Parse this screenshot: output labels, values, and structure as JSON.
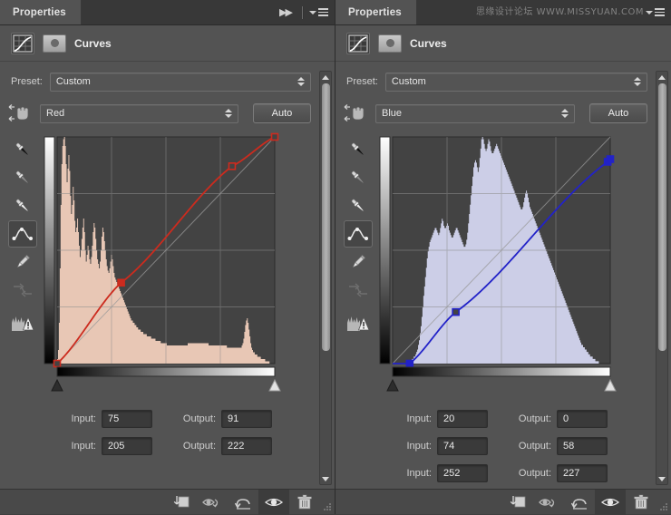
{
  "watermark": "思缘设计论坛  WWW.MISSYUAN.COM",
  "panels": [
    {
      "tab_label": "Properties",
      "title": "Curves",
      "preset_label": "Preset:",
      "preset_value": "Custom",
      "channel_value": "Red",
      "auto_label": "Auto",
      "curve_color": "#cc2b1e",
      "histogram_fill": "#f6d2bf",
      "input_label": "Input:",
      "output_label": "Output:",
      "points": [
        {
          "input": "75",
          "output": "91"
        },
        {
          "input": "205",
          "output": "222"
        }
      ],
      "icons": {
        "adjustment": "curves-adjustment-icon",
        "mask": "layer-mask-icon",
        "collapse": "collapse-panel-icon",
        "menu": "panel-menu-icon",
        "targeted_adjust": "targeted-adjustment-icon"
      },
      "tools": [
        "black-point-eyedropper-icon",
        "gray-point-eyedropper-icon",
        "white-point-eyedropper-icon",
        "curve-point-tool-icon",
        "pencil-tool-icon",
        "smooth-curve-icon",
        "clipping-warning-icon"
      ],
      "active_tool_index": 3,
      "bottom_buttons": [
        "clip-to-layer-icon",
        "view-previous-state-icon",
        "reset-adjustment-icon",
        "toggle-layer-visibility-icon",
        "delete-adjustment-layer-icon"
      ],
      "active_bottom_index": 3
    },
    {
      "tab_label": "Properties",
      "title": "Curves",
      "preset_label": "Preset:",
      "preset_value": "Custom",
      "channel_value": "Blue",
      "auto_label": "Auto",
      "curve_color": "#2222c8",
      "histogram_fill": "#d8daf5",
      "input_label": "Input:",
      "output_label": "Output:",
      "points": [
        {
          "input": "20",
          "output": "0"
        },
        {
          "input": "74",
          "output": "58"
        },
        {
          "input": "252",
          "output": "227"
        }
      ],
      "icons": {
        "adjustment": "curves-adjustment-icon",
        "mask": "layer-mask-icon",
        "collapse": "collapse-panel-icon",
        "menu": "panel-menu-icon",
        "targeted_adjust": "targeted-adjustment-icon"
      },
      "tools": [
        "black-point-eyedropper-icon",
        "gray-point-eyedropper-icon",
        "white-point-eyedropper-icon",
        "curve-point-tool-icon",
        "pencil-tool-icon",
        "smooth-curve-icon",
        "clipping-warning-icon"
      ],
      "active_tool_index": 3,
      "bottom_buttons": [
        "clip-to-layer-icon",
        "view-previous-state-icon",
        "reset-adjustment-icon",
        "toggle-layer-visibility-icon",
        "delete-adjustment-layer-icon"
      ],
      "active_bottom_index": 3
    }
  ],
  "chart_data": [
    {
      "type": "line",
      "title": "Red channel curve",
      "xlabel": "Input",
      "ylabel": "Output",
      "xlim": [
        0,
        255
      ],
      "ylim": [
        0,
        255
      ],
      "grid": true,
      "curve_points": [
        [
          0,
          0
        ],
        [
          75,
          91
        ],
        [
          205,
          222
        ],
        [
          255,
          255
        ]
      ],
      "baseline": [
        [
          0,
          0
        ],
        [
          255,
          255
        ]
      ],
      "histogram": [
        2,
        6,
        18,
        42,
        70,
        88,
        96,
        99,
        100,
        96,
        88,
        80,
        86,
        92,
        85,
        74,
        66,
        70,
        78,
        72,
        63,
        58,
        60,
        64,
        58,
        52,
        47,
        50,
        55,
        60,
        64,
        58,
        50,
        45,
        48,
        52,
        50,
        46,
        44,
        47,
        52,
        58,
        62,
        60,
        55,
        50,
        46,
        44,
        42,
        45,
        50,
        56,
        60,
        58,
        54,
        50,
        46,
        43,
        41,
        40,
        42,
        45,
        48,
        46,
        43,
        40,
        38,
        37,
        36,
        35,
        34,
        33,
        32,
        31,
        30,
        29,
        28,
        27,
        26,
        25,
        24,
        23,
        22,
        21,
        20,
        19,
        19,
        18,
        18,
        17,
        17,
        16,
        16,
        15,
        15,
        15,
        14,
        14,
        14,
        13,
        13,
        13,
        13,
        12,
        12,
        12,
        12,
        12,
        11,
        11,
        11,
        11,
        11,
        10,
        10,
        10,
        10,
        10,
        10,
        9,
        9,
        9,
        9,
        9,
        9,
        9,
        8,
        8,
        8,
        8,
        8,
        8,
        8,
        8,
        8,
        8,
        8,
        8,
        8,
        8,
        8,
        8,
        8,
        8,
        8,
        8,
        8,
        8,
        8,
        8,
        9,
        9,
        9,
        9,
        9,
        9,
        9,
        9,
        9,
        9,
        9,
        9,
        9,
        9,
        9,
        9,
        9,
        9,
        9,
        9,
        9,
        9,
        9,
        9,
        8,
        8,
        8,
        8,
        8,
        8,
        8,
        8,
        8,
        8,
        8,
        8,
        8,
        8,
        8,
        8,
        8,
        8,
        8,
        8,
        8,
        7,
        7,
        7,
        7,
        7,
        7,
        7,
        7,
        7,
        7,
        7,
        7,
        7,
        7,
        7,
        7,
        7,
        8,
        9,
        11,
        14,
        17,
        19,
        20,
        18,
        15,
        12,
        9,
        7,
        6,
        5,
        5,
        4,
        4,
        4,
        3,
        3,
        3,
        3,
        2,
        2,
        2,
        2,
        2,
        1,
        1,
        1,
        1,
        1,
        0,
        0,
        0,
        0,
        0,
        0
      ]
    },
    {
      "type": "line",
      "title": "Blue channel curve",
      "xlabel": "Input",
      "ylabel": "Output",
      "xlim": [
        0,
        255
      ],
      "ylim": [
        0,
        255
      ],
      "grid": true,
      "curve_points": [
        [
          20,
          0
        ],
        [
          74,
          58
        ],
        [
          252,
          227
        ],
        [
          255,
          230
        ]
      ],
      "baseline": [
        [
          0,
          0
        ],
        [
          255,
          255
        ]
      ],
      "histogram": [
        0,
        0,
        0,
        0,
        0,
        0,
        0,
        0,
        0,
        0,
        0,
        0,
        0,
        0,
        0,
        0,
        0,
        0,
        0,
        0,
        1,
        1,
        2,
        2,
        3,
        3,
        4,
        5,
        6,
        8,
        10,
        13,
        16,
        20,
        24,
        29,
        33,
        37,
        41,
        45,
        48,
        50,
        52,
        53,
        54,
        55,
        56,
        57,
        58,
        58,
        57,
        56,
        55,
        56,
        58,
        60,
        62,
        61,
        59,
        58,
        58,
        59,
        60,
        59,
        57,
        56,
        55,
        54,
        54,
        55,
        56,
        57,
        58,
        58,
        57,
        56,
        55,
        54,
        53,
        52,
        51,
        50,
        50,
        51,
        53,
        56,
        60,
        64,
        68,
        72,
        76,
        80,
        84,
        86,
        87,
        86,
        84,
        82,
        84,
        88,
        92,
        96,
        97,
        96,
        94,
        92,
        91,
        92,
        94,
        96,
        95,
        93,
        91,
        90,
        90,
        91,
        92,
        93,
        94,
        93,
        92,
        91,
        90,
        89,
        88,
        87,
        86,
        85,
        84,
        83,
        82,
        81,
        80,
        79,
        78,
        77,
        76,
        75,
        74,
        73,
        72,
        71,
        70,
        69,
        68,
        67,
        66,
        66,
        67,
        69,
        71,
        73,
        74,
        73,
        71,
        69,
        67,
        66,
        65,
        64,
        63,
        62,
        61,
        60,
        59,
        58,
        57,
        56,
        55,
        54,
        53,
        52,
        51,
        50,
        49,
        48,
        47,
        46,
        45,
        44,
        43,
        42,
        41,
        40,
        39,
        38,
        37,
        36,
        35,
        34,
        33,
        32,
        31,
        30,
        29,
        28,
        27,
        26,
        25,
        24,
        23,
        22,
        21,
        20,
        19,
        18,
        17,
        16,
        15,
        14,
        13,
        12,
        11,
        10,
        9,
        8,
        8,
        7,
        7,
        6,
        6,
        5,
        5,
        4,
        4,
        3,
        3,
        3,
        2,
        2,
        2,
        1,
        1,
        1,
        1,
        0,
        0,
        0,
        0,
        0,
        0,
        0,
        0,
        0,
        0,
        0,
        0,
        0
      ]
    }
  ]
}
